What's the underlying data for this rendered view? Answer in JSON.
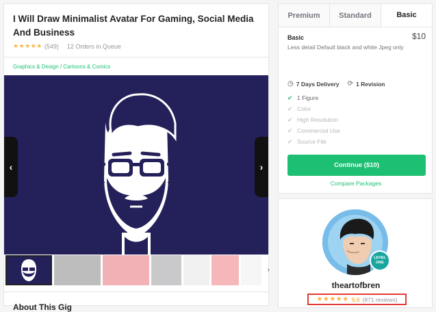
{
  "gig": {
    "title": "I Will Draw Minimalist Avatar For Gaming, Social Media And Business",
    "stars": "★★★★★",
    "rating_count": "(549)",
    "orders_in_queue": "12 Orders in Queue",
    "breadcrumb": "Graphics & Design / Cartoons & Comics",
    "prev_arrow": "‹",
    "next_arrow": "›",
    "thumb_next": "›",
    "about_heading": "About This Gig"
  },
  "packages": {
    "tabs": [
      {
        "label": "Premium"
      },
      {
        "label": "Standard"
      },
      {
        "label": "Basic"
      }
    ],
    "active_tab": "Basic",
    "name": "Basic",
    "price": "$10",
    "description": "Less detail Default black and white Jpeg only",
    "delivery": "7 Days Delivery",
    "revisions": "1 Revision",
    "features": [
      {
        "label": "1 Figure",
        "included": true
      },
      {
        "label": "Color",
        "included": false
      },
      {
        "label": "High Resolution",
        "included": false
      },
      {
        "label": "Commercial Use",
        "included": false
      },
      {
        "label": "Source File",
        "included": false
      }
    ],
    "continue_label": "Continue ($10)",
    "compare_label": "Compare Packages"
  },
  "seller": {
    "name": "theartofbren",
    "badge": "LEVEL ONE",
    "stars": "★★★★★",
    "score": "5.0",
    "reviews": "(871 reviews)"
  },
  "colors": {
    "accent_green": "#1dbf73",
    "star_orange": "#ffb33e",
    "image_bg": "#24205a",
    "highlight_red": "#e53935"
  },
  "icons": [
    "chevron-left-icon",
    "chevron-right-icon",
    "clock-icon",
    "refresh-icon",
    "check-icon"
  ]
}
